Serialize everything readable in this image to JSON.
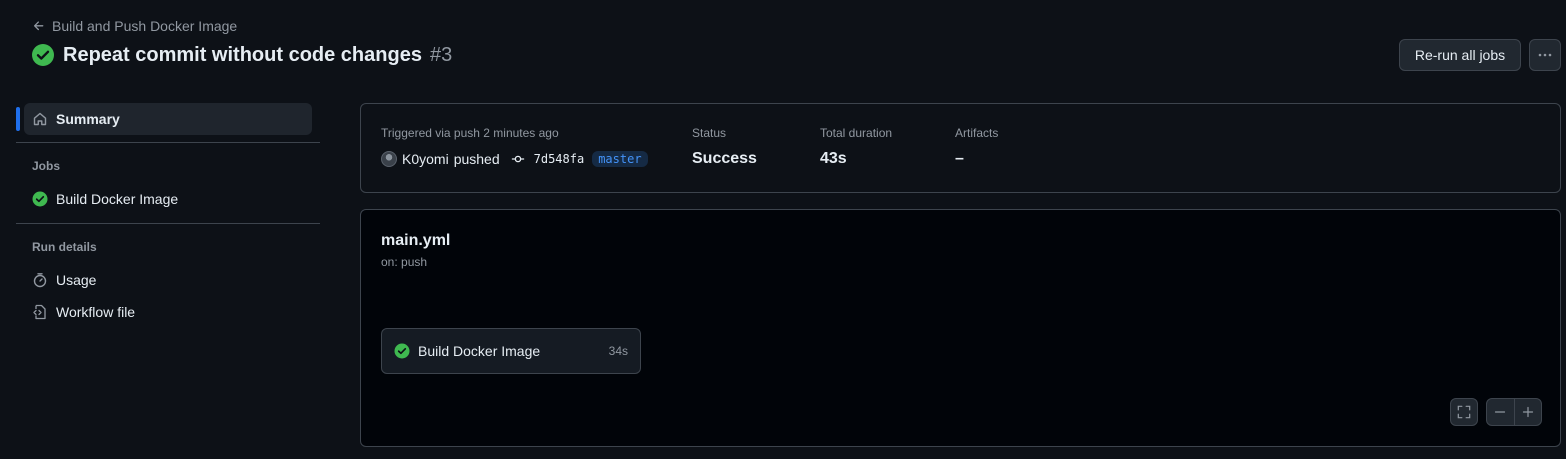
{
  "header": {
    "back_label": "Build and Push Docker Image",
    "title": "Repeat commit without code changes",
    "run_number": "#3",
    "rerun_label": "Re-run all jobs"
  },
  "sidebar": {
    "summary_label": "Summary",
    "jobs_heading": "Jobs",
    "jobs": [
      {
        "label": "Build Docker Image",
        "status": "success"
      }
    ],
    "run_details_heading": "Run details",
    "usage_label": "Usage",
    "workflow_file_label": "Workflow file"
  },
  "summary": {
    "trigger_label": "Triggered via push 2 minutes ago",
    "actor": "K0yomi",
    "action": "pushed",
    "commit_sha": "7d548fa",
    "branch": "master",
    "status_label": "Status",
    "status_value": "Success",
    "duration_label": "Total duration",
    "duration_value": "43s",
    "artifacts_label": "Artifacts",
    "artifacts_value": "–"
  },
  "workflow": {
    "file_name": "main.yml",
    "trigger": "on: push",
    "jobs": [
      {
        "label": "Build Docker Image",
        "duration": "34s",
        "status": "success"
      }
    ]
  },
  "colors": {
    "background": "#0d1117",
    "success": "#3fb950",
    "accent": "#1f6feb",
    "border": "#3d444d",
    "muted_text": "#9198a1"
  },
  "icons": [
    "arrow-left-icon",
    "check-circle-fill-icon",
    "kebab-horizontal-icon",
    "home-icon",
    "stopwatch-icon",
    "file-code-icon",
    "git-commit-icon",
    "screen-full-icon",
    "dash-icon",
    "plus-icon"
  ]
}
